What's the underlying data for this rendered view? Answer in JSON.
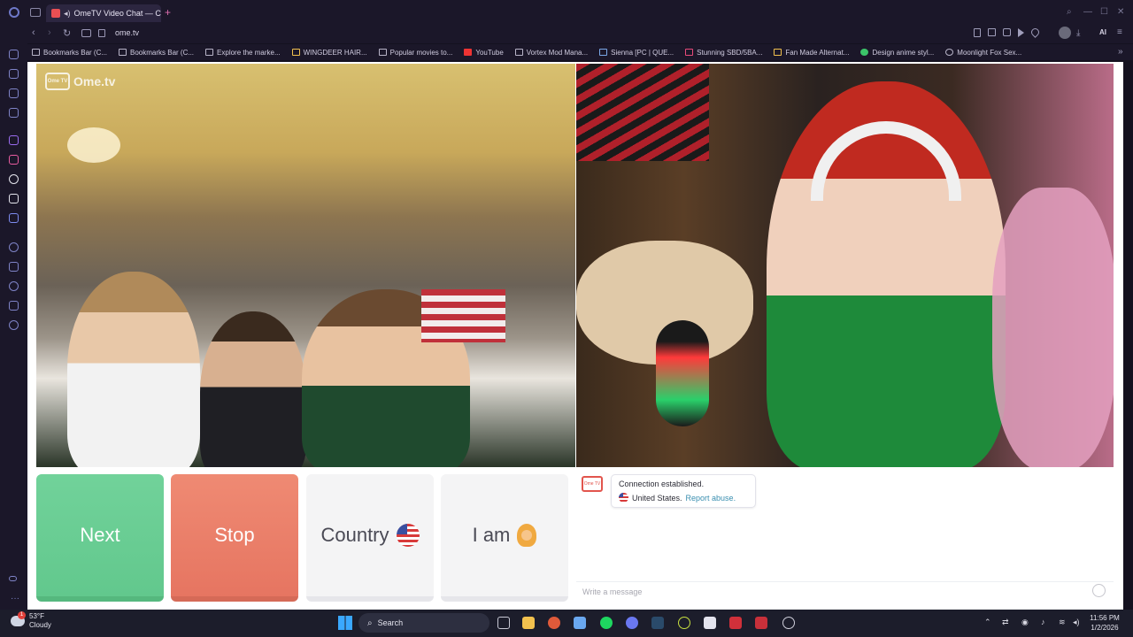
{
  "browser": {
    "tab_title": "OmeTV Video Chat — C",
    "new_tab": "+",
    "url": "ome.tv",
    "bookmarks": [
      "Bookmarks Bar (C...",
      "Bookmarks Bar (C...",
      "Explore the marke...",
      "WINGDEER HAIR...",
      "Popular movies to...",
      "YouTube",
      "Vortex Mod Mana...",
      "Sienna [PC | QUE...",
      "Stunning SBD/5BA...",
      "Fan Made Alternat...",
      "Design anime styl...",
      "Moonlight Fox Sex..."
    ],
    "ai_label": "AI",
    "nav": {
      "back": "‹",
      "forward": "›",
      "reload": "↻",
      "lock": "🔒"
    },
    "window_controls": {
      "minimize": "—",
      "maximize": "☐",
      "close": "✕"
    }
  },
  "page": {
    "logo_text": "Ome.tv",
    "logo_tv": "Ome TV",
    "buttons": {
      "next": "Next",
      "stop": "Stop",
      "country": "Country",
      "i_am": "I am"
    },
    "chat": {
      "status": "Connection established.",
      "country": "United States.",
      "report": "Report abuse.",
      "placeholder": "Write a message"
    }
  },
  "taskbar": {
    "temperature": "53°F",
    "condition": "Cloudy",
    "search_label": "Search",
    "time": "11:56 PM",
    "date": "1/2/2026",
    "notification_count": "1"
  },
  "colors": {
    "next": "#66cb90",
    "stop": "#ea7d67",
    "accent_link": "#3a8fb0"
  }
}
